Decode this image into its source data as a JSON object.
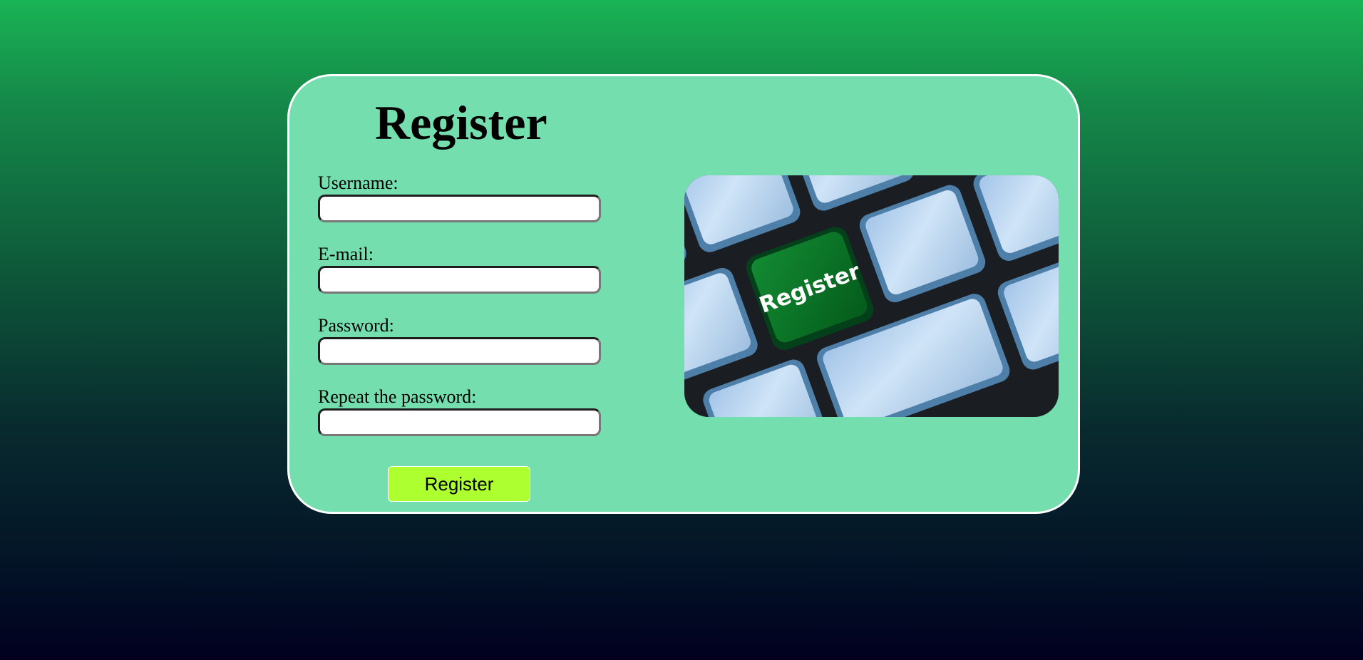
{
  "form": {
    "title": "Register",
    "fields": [
      {
        "label": "Username:",
        "value": "",
        "type": "text"
      },
      {
        "label": "E-mail:",
        "value": "",
        "type": "email"
      },
      {
        "label": "Password:",
        "value": "",
        "type": "password"
      },
      {
        "label": "Repeat the password:",
        "value": "",
        "type": "password"
      }
    ],
    "submit_label": "Register"
  },
  "illustration": {
    "key_label": "Register",
    "key_color": "#0a7a2a",
    "keys_color": "#b5d3ef"
  },
  "colors": {
    "card_background": "#75deae",
    "button_background": "#adff2f",
    "page_gradient_top": "#19b455",
    "page_gradient_bottom": "#01001f"
  }
}
